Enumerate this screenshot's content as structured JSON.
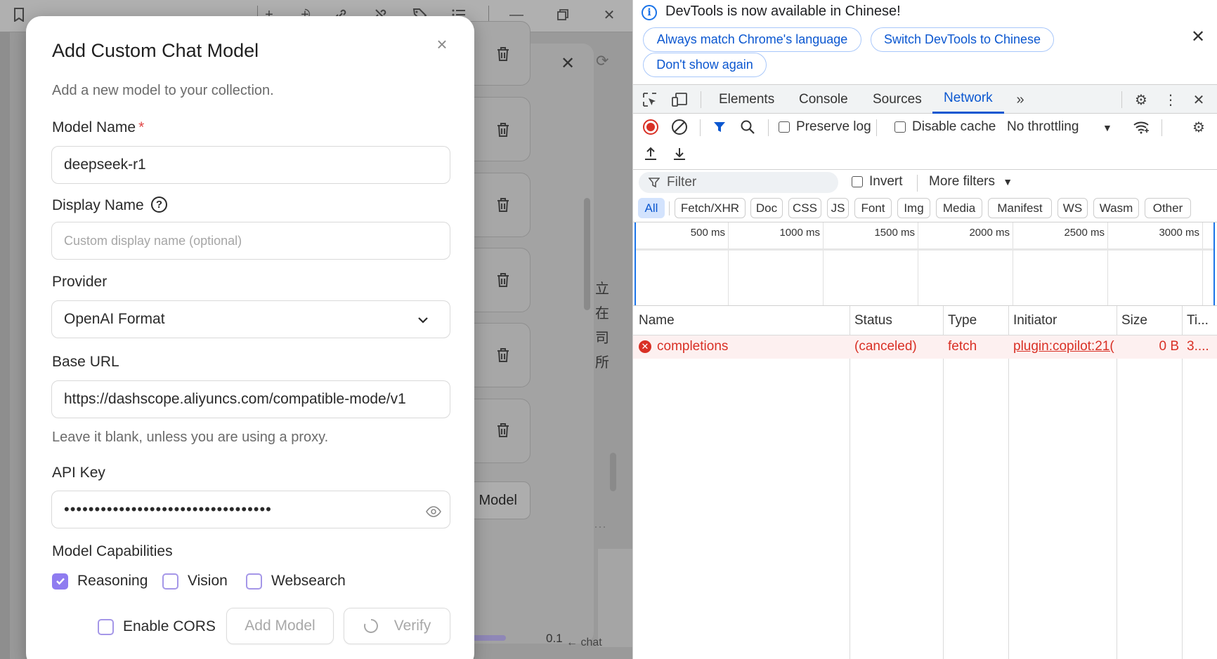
{
  "dialog": {
    "title": "Add Custom Chat Model",
    "subtitle": "Add a new model to your collection.",
    "model_name": {
      "label": "Model Name",
      "required_mark": "*",
      "value": "deepseek-r1"
    },
    "display_name": {
      "label": "Display Name",
      "placeholder": "Custom display name (optional)"
    },
    "provider": {
      "label": "Provider",
      "value": "OpenAI Format"
    },
    "base_url": {
      "label": "Base URL",
      "value": "https://dashscope.aliyuncs.com/compatible-mode/v1",
      "hint": "Leave it blank, unless you are using a proxy."
    },
    "api_key": {
      "label": "API Key",
      "value": "••••••••••••••••••••••••••••••••••"
    },
    "capabilities": {
      "label": "Model Capabilities",
      "reasoning": "Reasoning",
      "vision": "Vision",
      "websearch": "Websearch",
      "reasoning_checked": true,
      "vision_checked": false,
      "websearch_checked": false
    },
    "enable_cors": {
      "label": "Enable CORS",
      "checked": false
    },
    "add_model_label": "Add Model",
    "verify_label": "Verify"
  },
  "background": {
    "model_button_label": "Model",
    "cjk_chars": [
      "立",
      "在",
      "司",
      "所"
    ],
    "small_value": "0.1",
    "chat_label": "← chat"
  },
  "devtools": {
    "infobar": {
      "message": "DevTools is now available in Chinese!",
      "btn_match": "Always match Chrome's language",
      "btn_switch": "Switch DevTools to Chinese",
      "btn_dont_show": "Don't show again"
    },
    "tabs": [
      "Elements",
      "Console",
      "Sources",
      "Network"
    ],
    "active_tab": "Network",
    "toolbar": {
      "preserve_log": "Preserve log",
      "disable_cache": "Disable cache",
      "throttling": "No throttling"
    },
    "filter": {
      "placeholder": "Filter",
      "invert": "Invert",
      "more_filters": "More filters"
    },
    "types": [
      "All",
      "Fetch/XHR",
      "Doc",
      "CSS",
      "JS",
      "Font",
      "Img",
      "Media",
      "Manifest",
      "WS",
      "Wasm",
      "Other"
    ],
    "active_type": "All",
    "timeline_labels": [
      "500 ms",
      "1000 ms",
      "1500 ms",
      "2000 ms",
      "2500 ms",
      "3000 ms"
    ],
    "columns": [
      "Name",
      "Status",
      "Type",
      "Initiator",
      "Size",
      "Ti..."
    ],
    "requests": [
      {
        "name": "completions",
        "status": "(canceled)",
        "type": "fetch",
        "initiator": "plugin:copilot:21(",
        "size": "0 B",
        "time": "3...."
      }
    ],
    "colors": {
      "accent": "#0b57d0",
      "error": "#d93025"
    }
  }
}
